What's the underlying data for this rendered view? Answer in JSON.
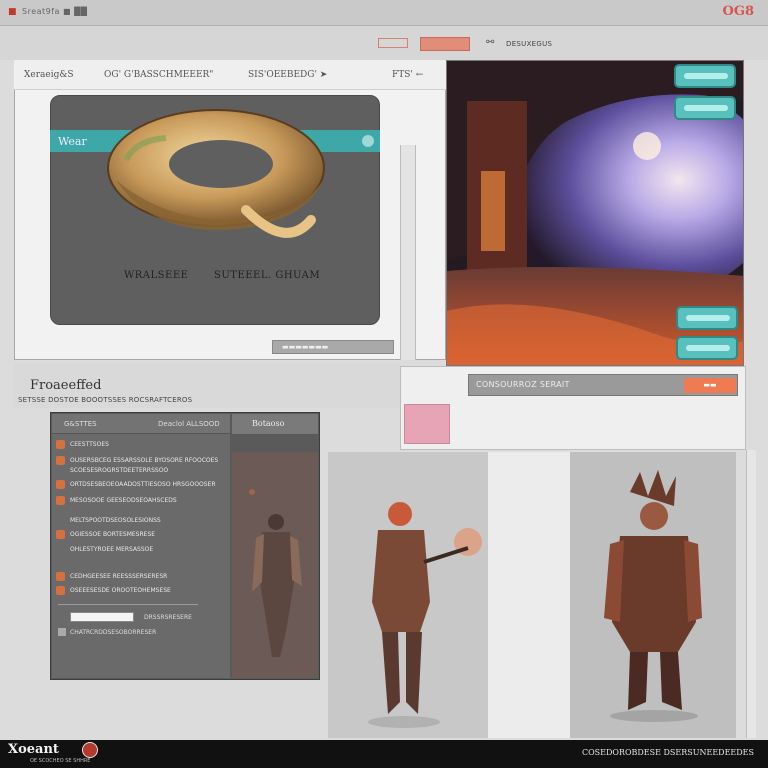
{
  "titlebar": {
    "left_text": "Sreat9fa ■ ██",
    "right_badge": "OG8"
  },
  "toolbar": {
    "button_label": "",
    "right_text": "DESUXEGUS"
  },
  "top_panel": {
    "header_left": "Xeraeig&S",
    "header_mid": "OG' G'BASSCHMEEER\"",
    "header_right": "SIS'OEEBEDG' ➤",
    "header_extra": "FTS' ←",
    "preview_bar_label": "Wear",
    "caption_left": "WRALSEEE",
    "caption_right": "SUTEEEL. GHUAM",
    "input_text": "▬▬▬▬▬▬▬"
  },
  "band": {
    "input_text": "CONSOURROZ SERAIT",
    "orange_label": "▬▬"
  },
  "left_lower": {
    "heading": "Froaeeffed",
    "subheading": "SETSSE DOSTOE BOOOTSSES ROCSRAFTCEROS"
  },
  "dark_panel": {
    "header_left": "G&STTES",
    "header_right": "Deaclol ALLSOOD",
    "tab_label": "Botaoso",
    "rows": [
      "CEESTTSOES",
      "OUSERSBCEG ESSARSSOLE BYOSORE RFOOCOES",
      "SCOESESROGRSTDEETERRSSOO",
      "ORTDSESBEOEOAADOSTTIESOSO HRSGOOOSER",
      "MESOSOOE GEESEODSEOAHSCEDS",
      "MELTSPOOTDSEOSOLESIONSS",
      "OGIESSOE BORTESMESRESE",
      "OHLESTYROEE MERSASSOE",
      "CEDHGEESEE REESSSERSERESR",
      "OSEEESESDE OROOTEOHEMSESE"
    ],
    "field_label": "DRSSRSRESERE",
    "field2_text": "CHATRCRDDSESOBORRESER"
  },
  "footer": {
    "logo": "Xoeant",
    "logo_sub": "OE SCOCHEO SE SHHRE",
    "right_text": "COSEDOROBDESE DSERSUNEEDEEDES"
  },
  "colors": {
    "teal": "#58c1bd",
    "orange": "#f07a52",
    "pink": "#e6a4b6",
    "panel_dark": "#5a5a5a"
  }
}
